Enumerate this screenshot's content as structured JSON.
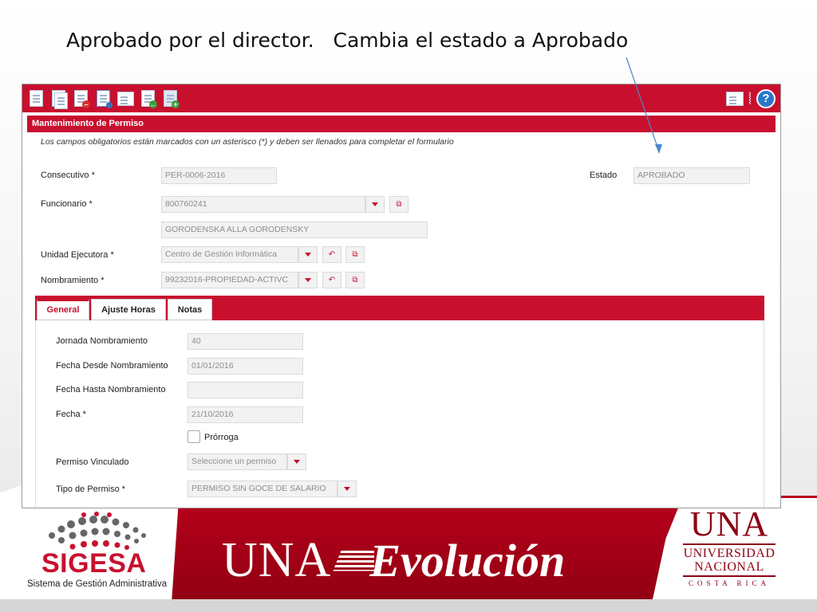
{
  "slide": {
    "title": "Aprobado por el director.   Cambia el estado a Aprobado"
  },
  "form": {
    "section_title": "Mantenimiento de Permiso",
    "required_note": "Los campos obligatorios están marcados con un asterisco (*) y deben ser llenados para completar el formulario",
    "consecutivo": {
      "label": "Consecutivo  *",
      "value": "PER-0006-2016"
    },
    "estado": {
      "label": "Estado",
      "value": "APROBADO"
    },
    "funcionario": {
      "label": "Funcionario  *",
      "value": "800760241",
      "name_value": "GORODENSKA  ALLA GORODENSKY"
    },
    "unidad": {
      "label": "Unidad Ejecutora  *",
      "value": "Centro de Gestión Informática"
    },
    "nombramiento": {
      "label": "Nombramiento  *",
      "value": "99232016-PROPIEDAD-ACTIVC"
    }
  },
  "tabs": [
    {
      "label": "General"
    },
    {
      "label": "Ajuste Horas"
    },
    {
      "label": "Notas"
    }
  ],
  "general": {
    "jornada": {
      "label": "Jornada Nombramiento",
      "value": "40"
    },
    "fecha_desde": {
      "label": "Fecha Desde Nombramiento",
      "value": "01/01/2016"
    },
    "fecha_hasta": {
      "label": "Fecha Hasta Nombramiento",
      "value": ""
    },
    "fecha": {
      "label": "Fecha  *",
      "value": "21/10/2016"
    },
    "prorroga": {
      "label": "Prórroga"
    },
    "permiso_vinculado": {
      "label": "Permiso Vinculado",
      "placeholder": "Seleccione un permiso"
    },
    "tipo_permiso": {
      "label": "Tipo de Permiso  *",
      "value": "PERMISO SIN GOCE DE SALARIO"
    }
  },
  "branding": {
    "sigesa": "SIGESA",
    "sigesa_sub": "Sistema de Gestión Administrativa",
    "una": "UNA",
    "evolucion": "Evolución",
    "logo_una": "UNA",
    "logo_universidad": "UNIVERSIDAD",
    "logo_nacional": "NACIONAL",
    "logo_country": "COSTA RICA"
  },
  "colors": {
    "accent": "#c8102e",
    "dark_red": "#8e0012",
    "help_blue": "#2a77c9"
  }
}
